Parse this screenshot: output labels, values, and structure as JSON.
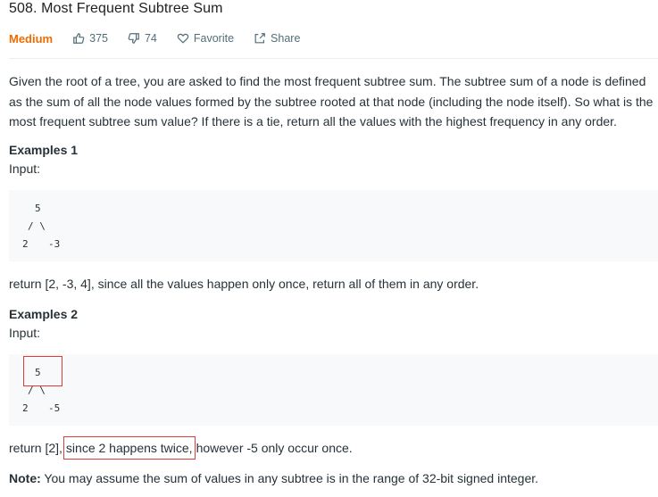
{
  "problem": {
    "title": "508. Most Frequent Subtree Sum",
    "difficulty": "Medium",
    "likes": "375",
    "dislikes": "74",
    "favorite_label": "Favorite",
    "share_label": "Share"
  },
  "description": "Given the root of a tree, you are asked to find the most frequent subtree sum. The subtree sum of a node is defined as the sum of all the node values formed by the subtree rooted at that node (including the node itself). So what is the most frequent subtree sum value? If there is a tie, return all the values with the highest frequency in any order.",
  "example1": {
    "heading": "Examples 1",
    "input_label": "Input:",
    "tree": {
      "root": "5",
      "branches": "/ \\",
      "left": "2",
      "right": "-3"
    },
    "result_text": "return [2, -3, 4], since all the values happen only once, return all of them in any order."
  },
  "example2": {
    "heading": "Examples 2",
    "input_label": "Input:",
    "tree": {
      "root": "5",
      "branches": "/ \\",
      "left": "2",
      "right": "-5"
    },
    "result_prefix": "return [2],",
    "result_highlight": "since 2 happens twice,",
    "result_suffix": "however -5 only occur once."
  },
  "note": {
    "label": "Note:",
    "text": " You may assume the sum of values in any subtree is in the range of 32-bit signed integer."
  },
  "colors": {
    "difficulty": "#ef6c00",
    "highlight_border": "#e53935",
    "code_bg": "#f7f9fa"
  }
}
